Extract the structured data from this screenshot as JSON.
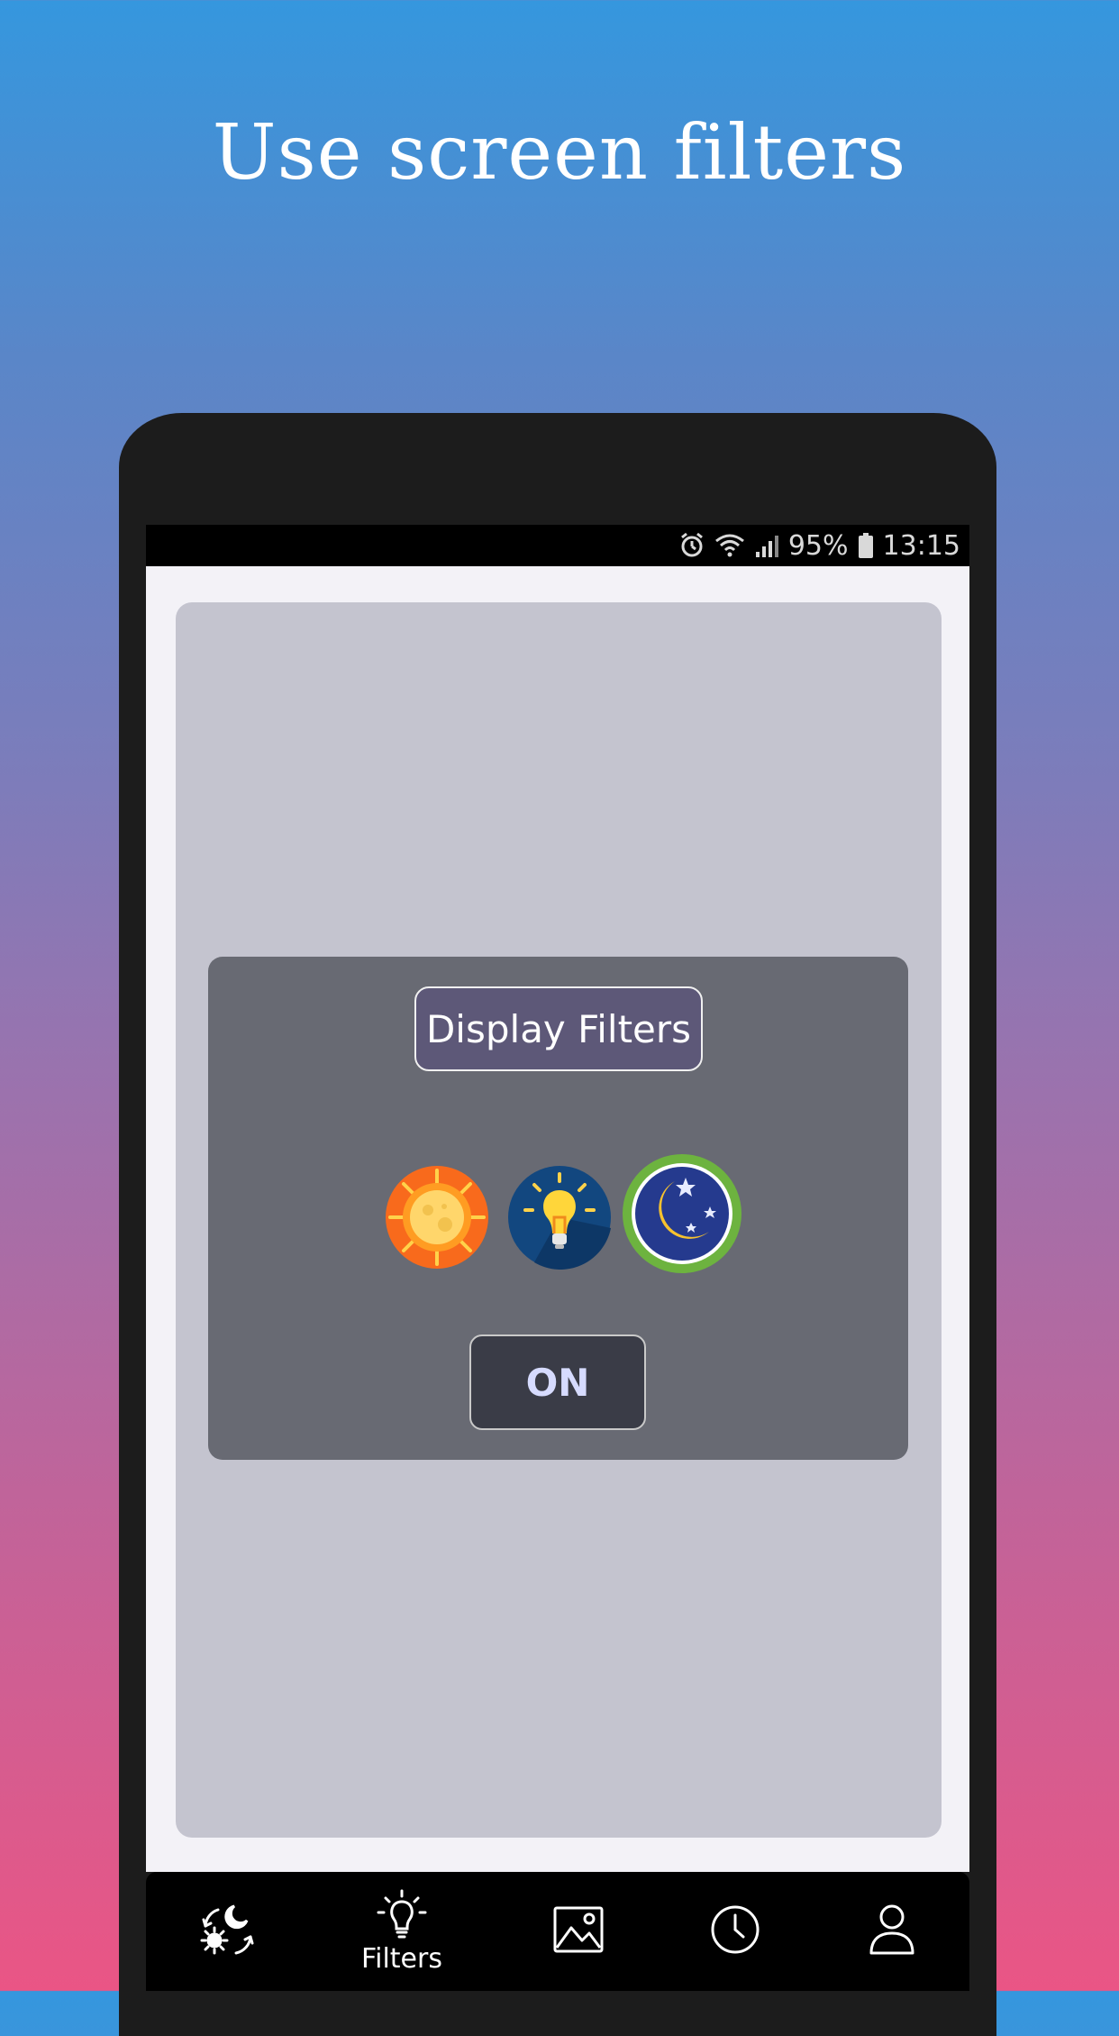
{
  "headline": "Use screen filters",
  "status_bar": {
    "battery_percent": "95%",
    "time": "13:15"
  },
  "dialog": {
    "title": "Display Filters",
    "filters": [
      {
        "icon": "sun-filter-icon",
        "selected": false
      },
      {
        "icon": "bulb-filter-icon",
        "selected": false
      },
      {
        "icon": "moon-filter-icon",
        "selected": true
      }
    ],
    "toggle_label": "ON"
  },
  "bottom_nav": {
    "items": [
      {
        "icon": "day-night-icon",
        "label": ""
      },
      {
        "icon": "bulb-icon",
        "label": "Filters",
        "active": true
      },
      {
        "icon": "image-icon",
        "label": ""
      },
      {
        "icon": "clock-icon",
        "label": ""
      },
      {
        "icon": "user-icon",
        "label": ""
      }
    ]
  },
  "colors": {
    "gradient_top": "#3597de",
    "gradient_bottom": "#ea5585",
    "dialog_bg": "#686a73",
    "title_button_bg": "#5d5878",
    "on_button_bg": "#3a3c47",
    "selected_ring": "#6db33f"
  }
}
